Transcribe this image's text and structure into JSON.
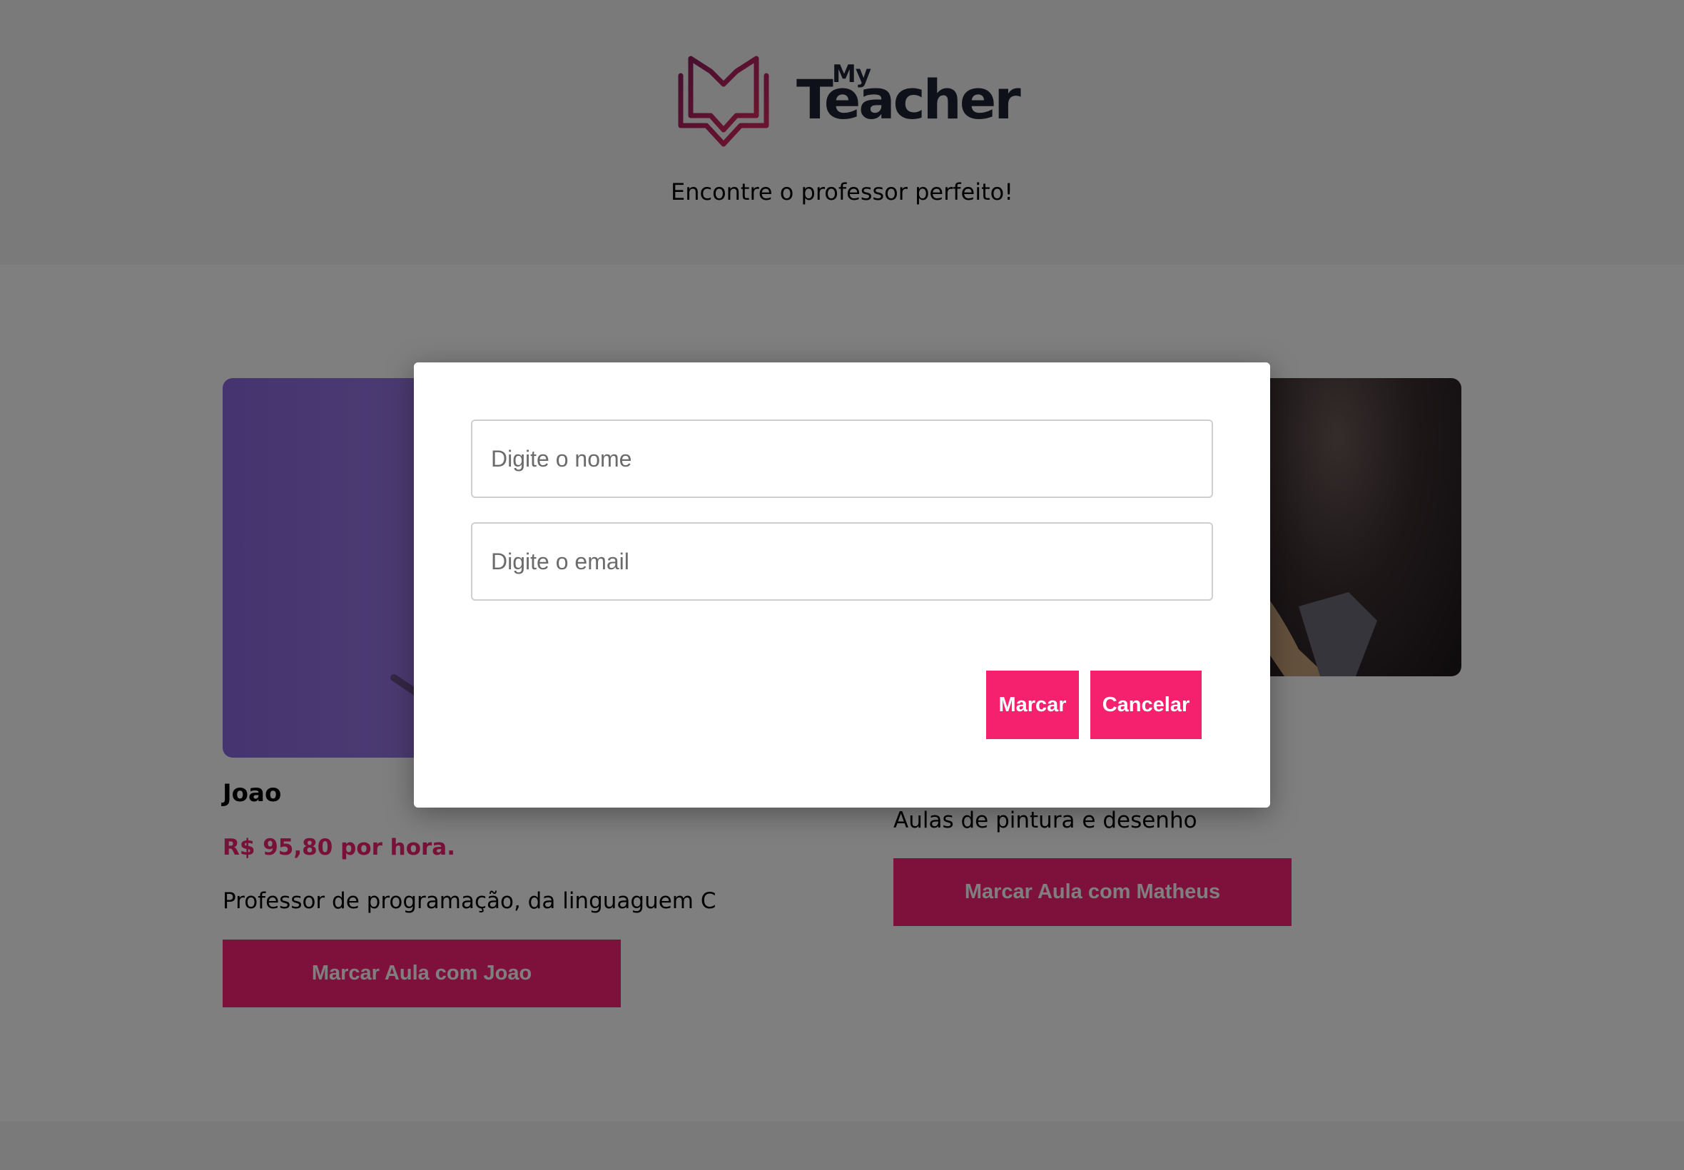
{
  "brand": {
    "logo_small": "My",
    "logo_large": "Teacher",
    "tagline": "Encontre o professor perfeito!"
  },
  "teachers": [
    {
      "name": "Joao",
      "price": "R$ 95,80 por hora.",
      "description": "Professor de programação, da linguaguem C",
      "button_label": "Marcar Aula com Joao"
    },
    {
      "description": "Aulas de pintura e desenho",
      "button_label": "Marcar Aula com Matheus"
    }
  ],
  "modal": {
    "name_placeholder": "Digite o nome",
    "email_placeholder": "Digite o email",
    "confirm_label": "Marcar",
    "cancel_label": "Cancelar"
  },
  "colors": {
    "accent": "#fb2377",
    "logo_gradient": [
      "#8f1f5e",
      "#e0285e"
    ],
    "logo_text": "#1e2235"
  },
  "icons": {
    "logo": "open-book-icon"
  }
}
